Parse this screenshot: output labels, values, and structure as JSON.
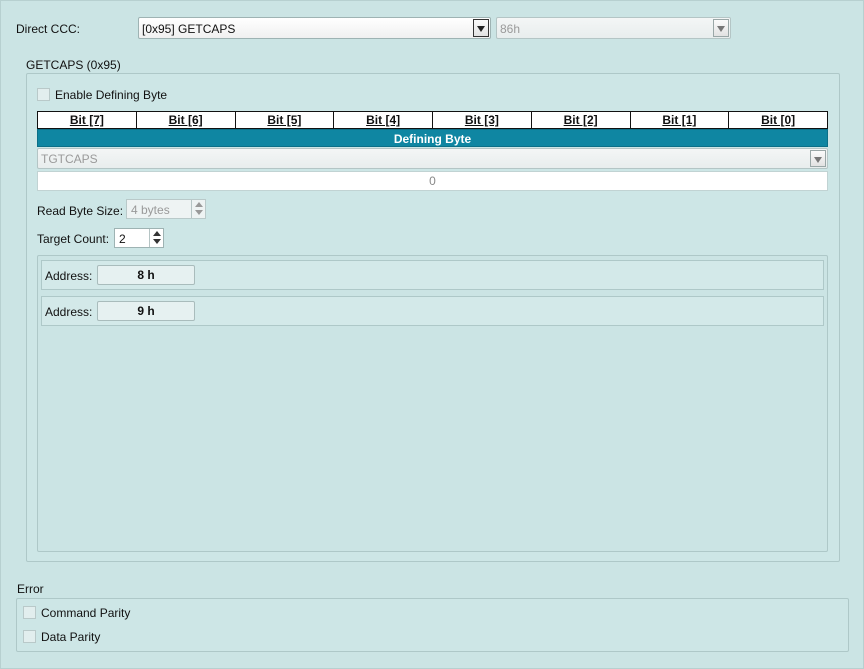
{
  "direct_ccc": {
    "label": "Direct CCC:",
    "selected": "[0x95] GETCAPS",
    "code_value": "86h"
  },
  "getcaps_group": {
    "title": "GETCAPS (0x95)",
    "enable_defining_byte": {
      "label": "Enable Defining Byte",
      "checked": false
    },
    "bits": [
      "Bit [7]",
      "Bit [6]",
      "Bit [5]",
      "Bit [4]",
      "Bit [3]",
      "Bit [2]",
      "Bit [1]",
      "Bit [0]"
    ],
    "defining_byte_label": "Defining Byte",
    "defining_byte_selected": "TGTCAPS",
    "defining_byte_value": "0",
    "read_byte_size": {
      "label": "Read Byte Size:",
      "value": "4 bytes"
    },
    "target_count": {
      "label": "Target Count:",
      "value": "2"
    },
    "targets": [
      {
        "label": "Address:",
        "value": "8 h"
      },
      {
        "label": "Address:",
        "value": "9 h"
      }
    ]
  },
  "error_group": {
    "title": "Error",
    "command_parity": {
      "label": "Command Parity",
      "checked": false
    },
    "data_parity": {
      "label": "Data Parity",
      "checked": false
    }
  },
  "colors": {
    "background": "#cbe4e4",
    "defining_byte_bar": "#0f86a2"
  }
}
